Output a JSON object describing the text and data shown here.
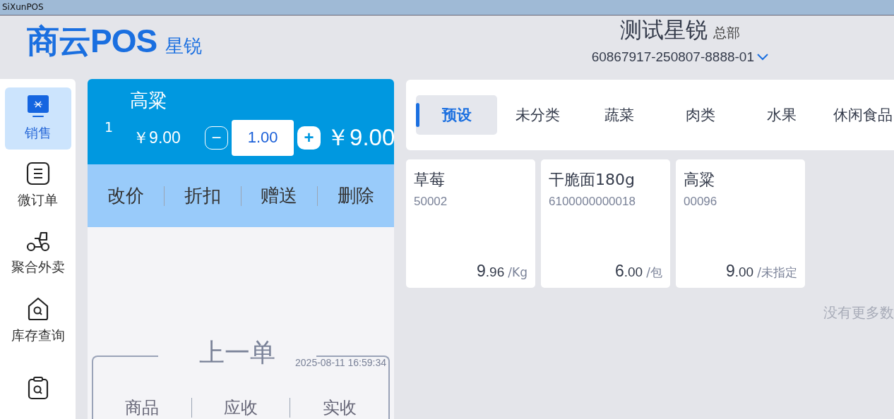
{
  "window": {
    "title": "SiXunPOS"
  },
  "header": {
    "logo": "商云POS",
    "logo_sub": "星锐",
    "store": "测试星锐",
    "branch": "总部",
    "device": "60867917-250807-8888-01"
  },
  "sidebar": {
    "items": [
      {
        "label": "销售",
        "selected": true
      },
      {
        "label": "微订单",
        "selected": false
      },
      {
        "label": "聚合外卖",
        "selected": false
      },
      {
        "label": "库存查询",
        "selected": false
      },
      {
        "selected": false
      }
    ]
  },
  "cart": {
    "line": {
      "index": "1",
      "name": "高粱",
      "price": "￥9.00",
      "quantity": "1.00",
      "minus": "−",
      "plus": "+",
      "total": "￥9.00"
    },
    "actions": [
      "改价",
      "折扣",
      "赠送",
      "删除"
    ],
    "last_order": {
      "title": "上一单",
      "time": "2025-08-11 16:59:34",
      "columns": [
        "商品",
        "应收",
        "实收"
      ]
    }
  },
  "categories": [
    {
      "label": "预设",
      "selected": true
    },
    {
      "label": "未分类",
      "selected": false
    },
    {
      "label": "蔬菜",
      "selected": false
    },
    {
      "label": "肉类",
      "selected": false
    },
    {
      "label": "水果",
      "selected": false
    },
    {
      "label": "休闲食品",
      "selected": false
    }
  ],
  "products": [
    {
      "name": "草莓",
      "code": "50002",
      "price_int": "9",
      "price_dec": ".96",
      "unit": "/Kg"
    },
    {
      "name": "干脆面180g",
      "code": "6100000000018",
      "price_int": "6",
      "price_dec": ".00",
      "unit": "/包"
    },
    {
      "name": "高粱",
      "code": "00096",
      "price_int": "9",
      "price_dec": ".00",
      "unit": "/未指定"
    }
  ],
  "end_note": "没有更多数"
}
